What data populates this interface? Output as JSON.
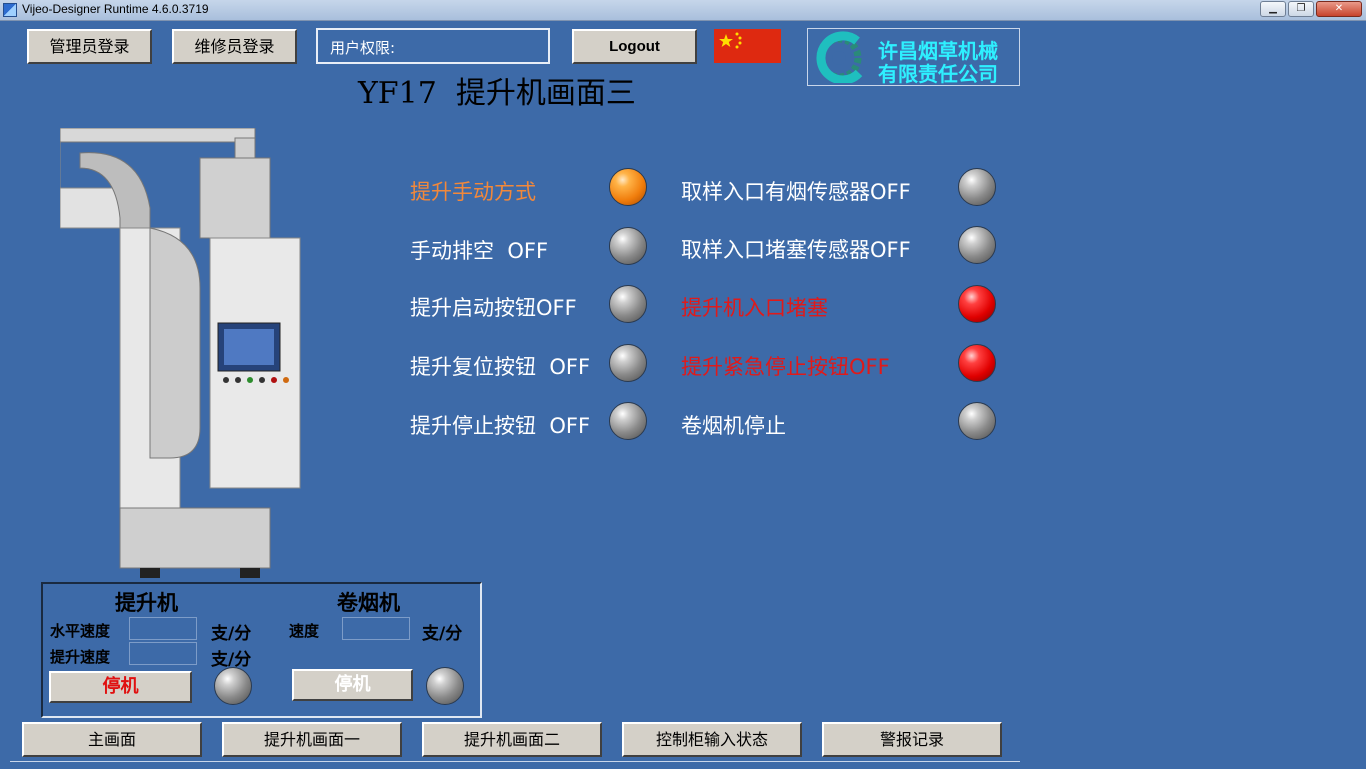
{
  "window": {
    "title": "Vijeo-Designer Runtime 4.6.0.3719"
  },
  "header": {
    "admin_login": "管理员登录",
    "maint_login": "维修员登录",
    "user_rights": "用户权限:",
    "logout": "Logout",
    "company_line1": "许昌烟草机械",
    "company_line2": "有限责任公司",
    "page_title": "YF17  提升机画面三"
  },
  "status_left": [
    {
      "label": "提升手动方式",
      "state": "orange",
      "text_color": "#f2883a"
    },
    {
      "label": "手动排空  OFF",
      "state": "gray",
      "text_color": "#ffffff"
    },
    {
      "label": "提升启动按钮OFF",
      "state": "gray",
      "text_color": "#ffffff"
    },
    {
      "label": "提升复位按钮  OFF",
      "state": "gray",
      "text_color": "#ffffff"
    },
    {
      "label": "提升停止按钮  OFF",
      "state": "gray",
      "text_color": "#ffffff"
    }
  ],
  "status_right": [
    {
      "label": "取样入口有烟传感器OFF",
      "state": "gray",
      "text_color": "#ffffff"
    },
    {
      "label": "取样入口堵塞传感器OFF",
      "state": "gray",
      "text_color": "#ffffff"
    },
    {
      "label": "提升机入口堵塞",
      "state": "red",
      "text_color": "#e01a1a"
    },
    {
      "label": "提升紧急停止按钮OFF",
      "state": "red",
      "text_color": "#e01a1a"
    },
    {
      "label": "卷烟机停止",
      "state": "gray",
      "text_color": "#ffffff"
    }
  ],
  "speed_panel": {
    "lift_title": "提升机",
    "maker_title": "卷烟机",
    "horizontal_speed": "水平速度",
    "lift_speed": "提升速度",
    "speed": "速度",
    "unit": "支/分",
    "lift_stop": "停机",
    "maker_stop": "停机"
  },
  "nav": {
    "main": "主画面",
    "lift1": "提升机画面一",
    "lift2": "提升机画面二",
    "cabinet_input": "控制柜输入状态",
    "alarm_log": "警报记录"
  },
  "colors": {
    "background": "#3d6aa8",
    "orange_lamp": "#f07d0c",
    "red_lamp": "#e00000",
    "gray_lamp": "#8a8a8a"
  }
}
